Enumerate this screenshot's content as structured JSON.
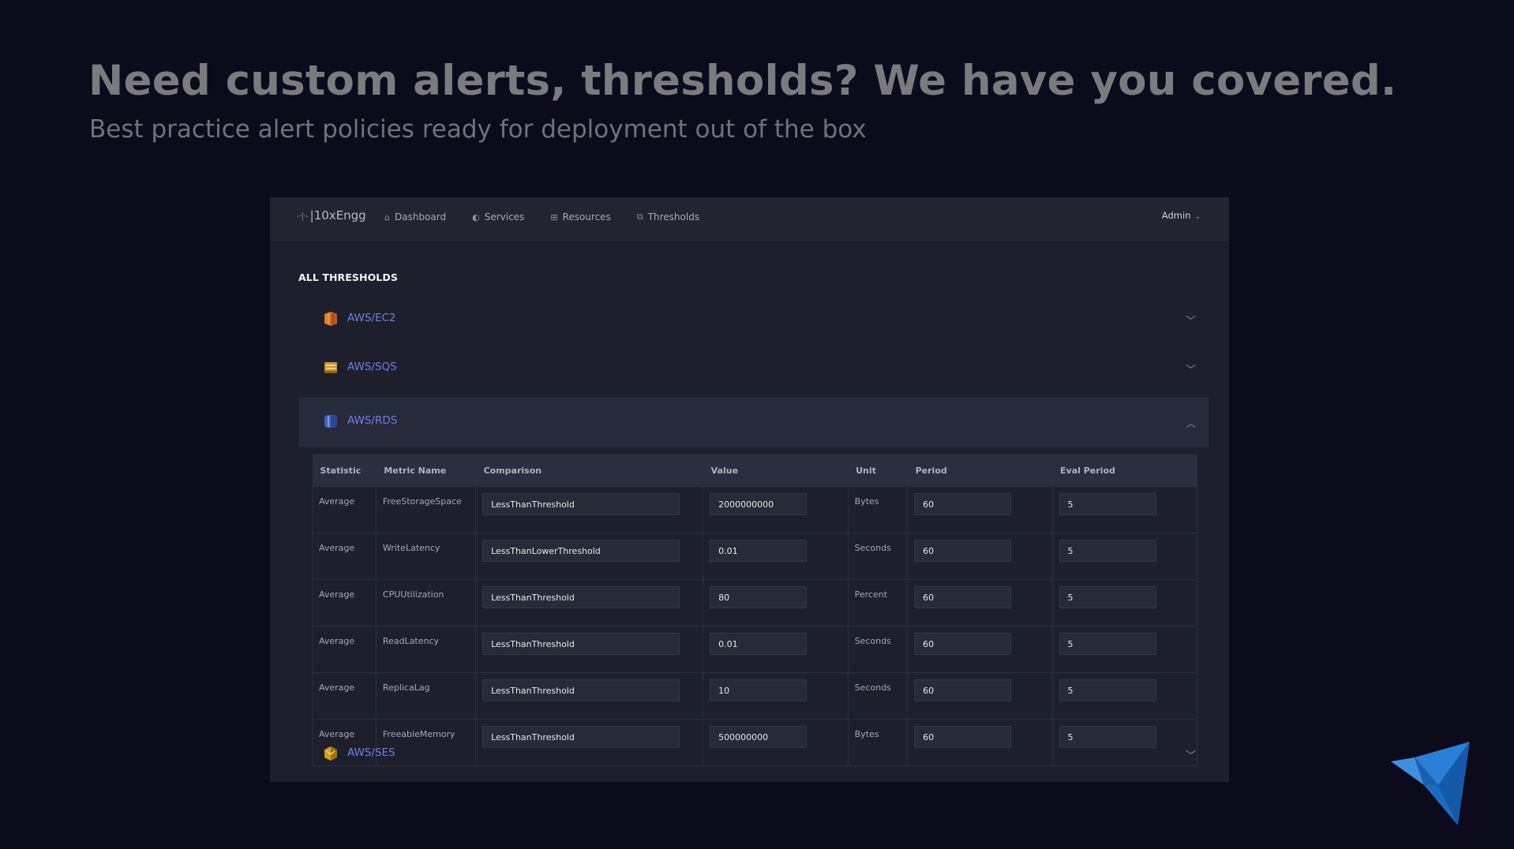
{
  "promo": {
    "headline": "Need custom alerts, thresholds? We have you covered.",
    "subheadline": "Best practice alert policies ready for deployment out of the box"
  },
  "nav": {
    "logo_mark": "-·|·-",
    "logo_text": "|10xEngg",
    "items": [
      {
        "label": "Dashboard",
        "icon": "home-icon"
      },
      {
        "label": "Services",
        "icon": "services-icon"
      },
      {
        "label": "Resources",
        "icon": "resources-icon"
      },
      {
        "label": "Thresholds",
        "icon": "thresholds-icon"
      }
    ],
    "user": "Admin"
  },
  "section_title": "ALL THRESHOLDS",
  "groups": [
    {
      "label": "AWS/EC2",
      "icon": "aws-ec2-icon",
      "expanded": false
    },
    {
      "label": "AWS/SQS",
      "icon": "aws-sqs-icon",
      "expanded": false
    },
    {
      "label": "AWS/RDS",
      "icon": "aws-rds-icon",
      "expanded": true
    },
    {
      "label": "AWS/SES",
      "icon": "aws-ses-icon",
      "expanded": false
    }
  ],
  "table": {
    "headers": [
      "Statistic",
      "Metric Name",
      "Comparison",
      "Value",
      "Unit",
      "Period",
      "Eval Period"
    ],
    "rows": [
      {
        "statistic": "Average",
        "metric": "FreeStorageSpace",
        "comparison": "LessThanThreshold",
        "value": "2000000000",
        "unit": "Bytes",
        "period": "60",
        "eval_period": "5"
      },
      {
        "statistic": "Average",
        "metric": "WriteLatency",
        "comparison": "LessThanLowerThreshold",
        "value": "0.01",
        "unit": "Seconds",
        "period": "60",
        "eval_period": "5"
      },
      {
        "statistic": "Average",
        "metric": "CPUUtilization",
        "comparison": "LessThanThreshold",
        "value": "80",
        "unit": "Percent",
        "period": "60",
        "eval_period": "5"
      },
      {
        "statistic": "Average",
        "metric": "ReadLatency",
        "comparison": "LessThanThreshold",
        "value": "0.01",
        "unit": "Seconds",
        "period": "60",
        "eval_period": "5"
      },
      {
        "statistic": "Average",
        "metric": "ReplicaLag",
        "comparison": "LessThanThreshold",
        "value": "10",
        "unit": "Seconds",
        "period": "60",
        "eval_period": "5"
      },
      {
        "statistic": "Average",
        "metric": "FreeableMemory",
        "comparison": "LessThanThreshold",
        "value": "500000000",
        "unit": "Bytes",
        "period": "60",
        "eval_period": "5"
      }
    ]
  },
  "colors": {
    "accent_link": "#6f7fe0",
    "ec2": "#e07b2e",
    "sqs": "#c9962f",
    "rds": "#3f64c0",
    "ses": "#d4a020",
    "brand_bird": "#2a7fd6"
  }
}
